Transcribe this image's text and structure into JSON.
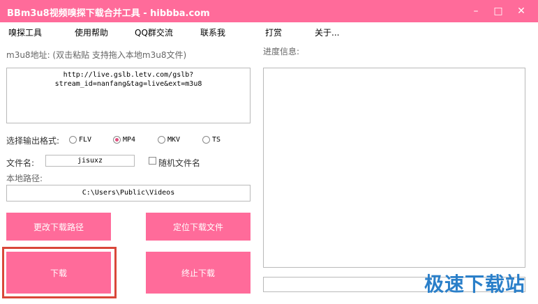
{
  "window": {
    "title": "BBm3u8视频嗅探下载合并工具 - hibbba.com",
    "controls": {
      "minimize": "–",
      "maximize": "□",
      "close": "✕"
    }
  },
  "menu": [
    "嗅探工具",
    "使用帮助",
    "QQ群交流",
    "联系我",
    "打赏",
    "关于..."
  ],
  "m3u8": {
    "label": "m3u8地址: (双击粘贴 支持拖入本地m3u8文件)",
    "url_line1": "http://live.gslb.letv.com/gslb?",
    "url_line2": "stream_id=nanfang&tag=live&ext=m3u8"
  },
  "format": {
    "label": "选择输出格式:",
    "options": [
      "FLV",
      "MP4",
      "MKV",
      "TS"
    ],
    "selected": "MP4"
  },
  "filename": {
    "label": "文件名:",
    "value": "jisuxz",
    "random_label": "随机文件名"
  },
  "path": {
    "label": "本地路径:",
    "value": "C:\\Users\\Public\\Videos"
  },
  "buttons": {
    "change_path": "更改下载路径",
    "locate_file": "定位下载文件",
    "download": "下载",
    "stop": "终止下载"
  },
  "progress": {
    "label": "进度信息:"
  },
  "watermark": "极速下载站",
  "colors": {
    "accent": "#ff6b9a",
    "highlight": "#d9473a",
    "watermark": "#2a7fc9"
  }
}
